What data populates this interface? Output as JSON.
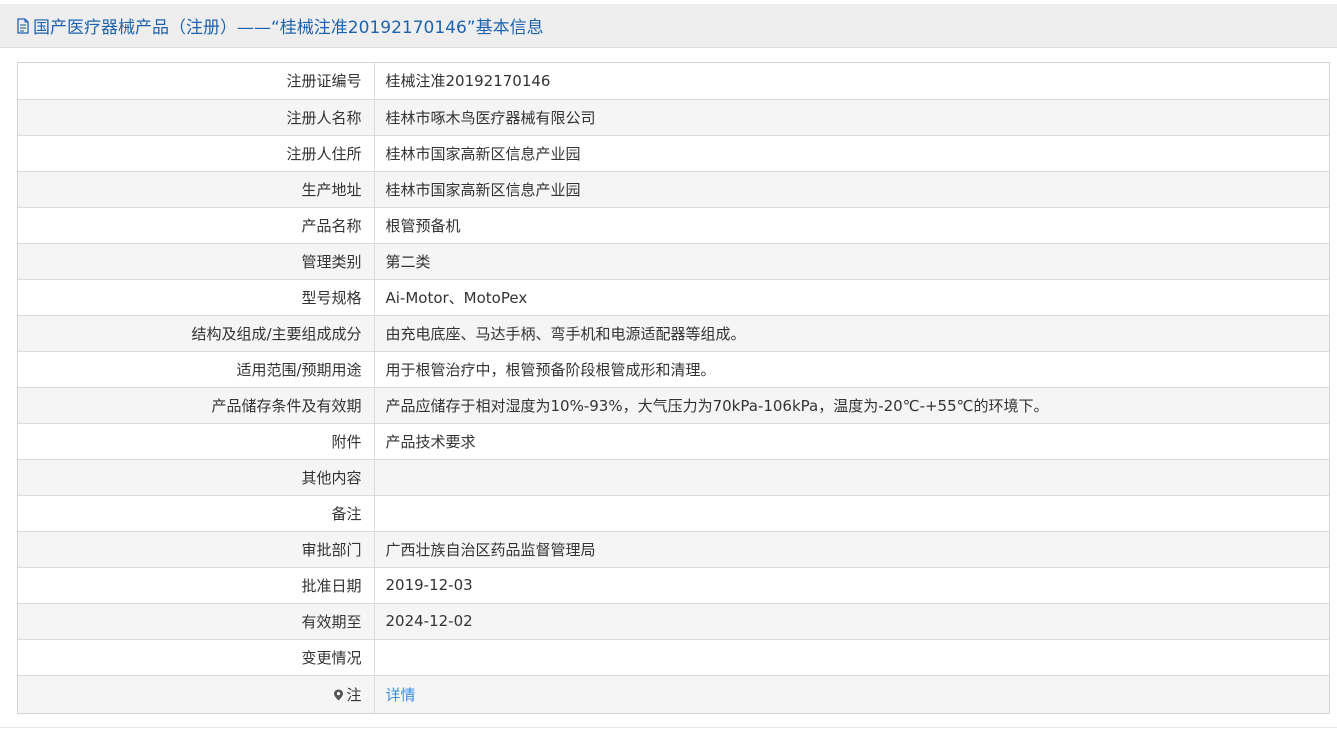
{
  "header": {
    "title": "国产医疗器械产品（注册）——“桂械注准20192170146”基本信息",
    "icon": "document-icon",
    "title_color": "#1e63b0"
  },
  "rows": [
    {
      "label": "注册证编号",
      "value": "桂械注准20192170146"
    },
    {
      "label": "注册人名称",
      "value": "桂林市啄木鸟医疗器械有限公司"
    },
    {
      "label": "注册人住所",
      "value": "桂林市国家高新区信息产业园"
    },
    {
      "label": "生产地址",
      "value": "桂林市国家高新区信息产业园"
    },
    {
      "label": "产品名称",
      "value": "根管预备机"
    },
    {
      "label": "管理类别",
      "value": "第二类"
    },
    {
      "label": "型号规格",
      "value": "Ai-Motor、MotoPex"
    },
    {
      "label": "结构及组成/主要组成成分",
      "value": "由充电底座、马达手柄、弯手机和电源适配器等组成。"
    },
    {
      "label": "适用范围/预期用途",
      "value": "用于根管治疗中，根管预备阶段根管成形和清理。"
    },
    {
      "label": "产品储存条件及有效期",
      "value": "产品应储存于相对湿度为10%-93%，大气压力为70kPa-106kPa，温度为-20℃-+55℃的环境下。"
    },
    {
      "label": "附件",
      "value": "产品技术要求"
    },
    {
      "label": "其他内容",
      "value": ""
    },
    {
      "label": "备注",
      "value": ""
    },
    {
      "label": "审批部门",
      "value": "广西壮族自治区药品监督管理局"
    },
    {
      "label": "批准日期",
      "value": "2019-12-03"
    },
    {
      "label": "有效期至",
      "value": "2024-12-02"
    },
    {
      "label": "变更情况",
      "value": ""
    }
  ],
  "note": {
    "icon": "map-pin-icon",
    "label": "注",
    "link_text": "详情",
    "link_color": "#3a8ee6"
  }
}
